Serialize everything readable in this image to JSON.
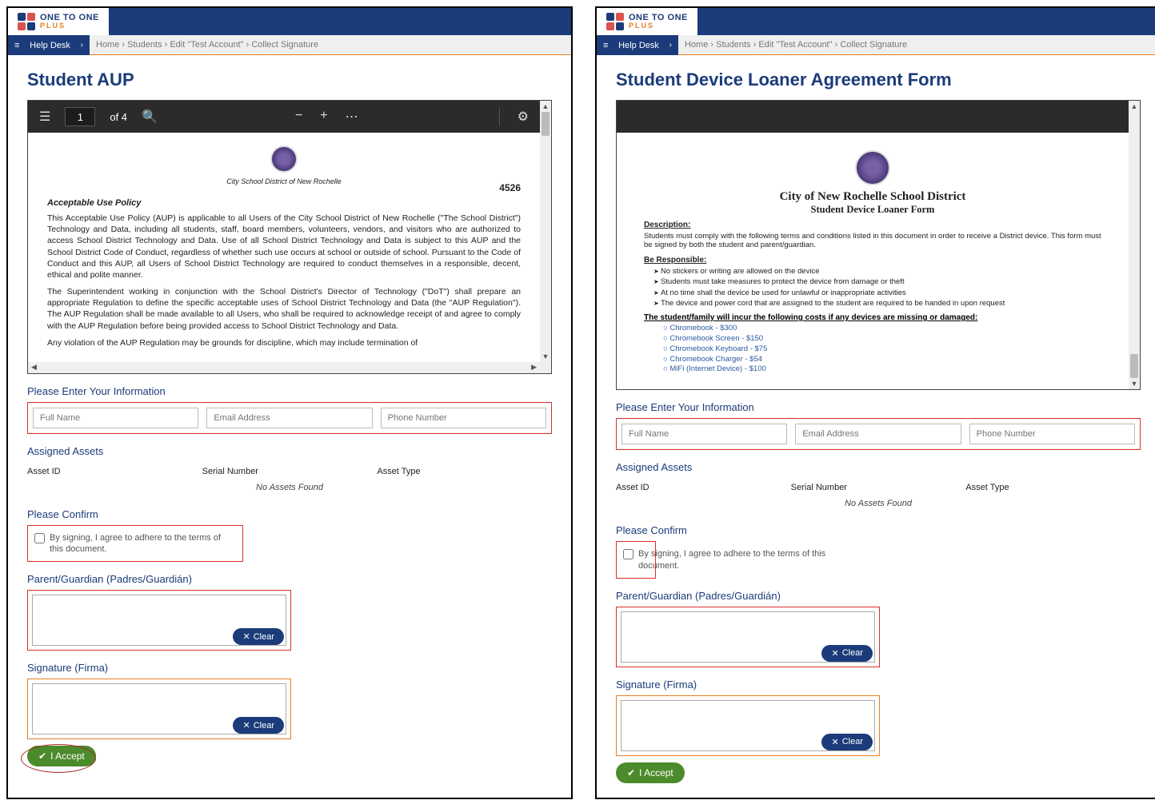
{
  "brand": {
    "line1": "ONE TO ONE",
    "line2": "PLUS"
  },
  "helpdesk": {
    "icon": "≡",
    "label": "Help Desk",
    "chevron": "›"
  },
  "breadcrumb": {
    "home": "Home",
    "students": "Students",
    "edit": "Edit \"Test Account\"",
    "collect": "Collect Signature"
  },
  "left": {
    "title": "Student AUP",
    "pdf": {
      "page_value": "1",
      "page_total": "of 4",
      "doc_number": "4526",
      "district": "City School District of New Rochelle",
      "aup_heading": "Acceptable Use Policy",
      "p1": "This Acceptable Use Policy (AUP) is applicable to all Users of the City School District of New Rochelle (\"The School District\") Technology and Data, including all students, staff, board members, volunteers, vendors, and visitors who are authorized to access School District Technology and Data. Use of all School District Technology and Data is subject to this AUP and the School District Code of Conduct, regardless of whether such use occurs at school or outside of school. Pursuant to the Code of Conduct and this AUP, all Users of School District Technology are required to conduct themselves in a responsible, decent, ethical and polite manner.",
      "p2": "The Superintendent working in conjunction with the School District's Director of Technology (\"DoT\") shall prepare an appropriate Regulation to define the specific acceptable uses of School District Technology and Data (the \"AUP Regulation\"). The AUP Regulation shall be made available to all Users, who shall be required to acknowledge receipt of and agree to comply with the AUP Regulation before being provided access to School District Technology and Data.",
      "p3": "Any violation of the AUP Regulation may be grounds for discipline, which may include termination of"
    }
  },
  "right": {
    "title": "Student Device Loaner Agreement Form",
    "doc": {
      "h1": "City of New Rochelle School District",
      "h2": "Student Device Loaner Form",
      "desc_label": "Description:",
      "desc_text": "Students must comply with the following terms and conditions listed in this document in order to receive a District device.  This form must be signed by both the student and parent/guardian.",
      "resp_label": "Be Responsible:",
      "resp_items": [
        "No stickers or writing are allowed on the device",
        "Students must take measures to protect the device from damage or theft",
        "At no time shall the device be used for unlawful or inappropriate activities",
        "The device and power cord that are assigned to the student are required to be handed in upon request"
      ],
      "cost_label": "The student/family will incur the following costs if any devices are missing or damaged:",
      "cost_items": [
        "Chromebook - $300",
        "Chromebook Screen - $150",
        "Chromebook Keyboard - $75",
        "Chromebook Charger - $54",
        "MiFi (Internet Device) - $100"
      ]
    }
  },
  "form": {
    "info_label": "Please Enter Your Information",
    "full_name_ph": "Full Name",
    "email_ph": "Email Address",
    "phone_ph": "Phone Number",
    "assets_label": "Assigned Assets",
    "col_id": "Asset ID",
    "col_serial": "Serial Number",
    "col_type": "Asset Type",
    "no_assets": "No Assets Found",
    "confirm_label": "Please Confirm",
    "confirm_text": "By signing, I agree to adhere to the terms of this document.",
    "parent_label": "Parent/Guardian (Padres/Guardián)",
    "sig_label": "Signature (Firma)",
    "clear_btn": "Clear",
    "accept_btn": "I Accept"
  }
}
